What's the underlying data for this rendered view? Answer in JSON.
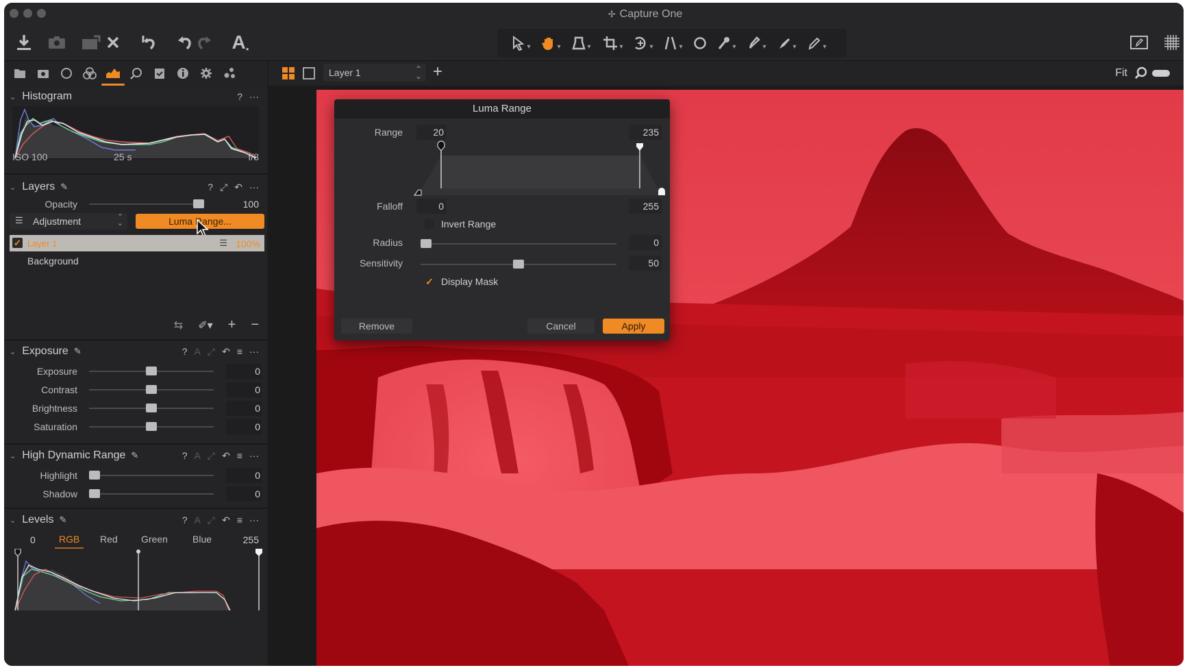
{
  "window": {
    "title": "Capture One",
    "title_icon": "capture-one-logo-icon"
  },
  "toolbar": {
    "left_icons": [
      "import-icon",
      "camera-capture-icon",
      "export-icon",
      "delete-icon",
      "reset-icon",
      "undo-icon",
      "redo-icon",
      "text-annotation-icon"
    ],
    "cursor_tools": [
      "select-cursor-icon",
      "pan-hand-icon",
      "loupe-icon",
      "crop-icon",
      "rotate-icon",
      "keystone-icon",
      "spot-removal-icon",
      "color-picker-icon",
      "brush-icon",
      "erase-brush-icon",
      "annotate-pencil-icon"
    ],
    "active_cursor_tool": "pan-hand-icon",
    "right_icons": [
      "proof-view-icon",
      "grid-overlay-icon"
    ]
  },
  "tool_tabs": {
    "items": [
      "library-tab",
      "capture-tab",
      "lens-tab",
      "color-tab",
      "exposure-tab",
      "details-tab",
      "adjustments-tab",
      "metadata-tab",
      "output-tab",
      "batch-tab"
    ],
    "active": "exposure-tab"
  },
  "viewer_bar": {
    "layer_select": "Layer 1",
    "zoom_label": "Fit"
  },
  "histogram": {
    "title": "Histogram",
    "iso": "ISO 100",
    "shutter": "25 s",
    "aperture": "f/8"
  },
  "layers": {
    "title": "Layers",
    "opacity_label": "Opacity",
    "opacity_value": "100",
    "opacity_fraction": 1.0,
    "mode_label": "Adjustment",
    "luma_button": "Luma Range...",
    "items": [
      {
        "name": "Layer 1",
        "opacity": "100%",
        "checked": true,
        "selected": true
      },
      {
        "name": "Background",
        "opacity": "",
        "checked": false,
        "selected": false
      }
    ]
  },
  "exposure": {
    "title": "Exposure",
    "sliders": [
      {
        "label": "Exposure",
        "value": "0",
        "fraction": 0.5
      },
      {
        "label": "Contrast",
        "value": "0",
        "fraction": 0.5
      },
      {
        "label": "Brightness",
        "value": "0",
        "fraction": 0.5
      },
      {
        "label": "Saturation",
        "value": "0",
        "fraction": 0.5
      }
    ]
  },
  "hdr": {
    "title": "High Dynamic Range",
    "sliders": [
      {
        "label": "Highlight",
        "value": "0",
        "fraction": 0.0
      },
      {
        "label": "Shadow",
        "value": "0",
        "fraction": 0.0
      }
    ]
  },
  "levels": {
    "title": "Levels",
    "low_value": "0",
    "high_value": "255",
    "channels": [
      "RGB",
      "Red",
      "Green",
      "Blue"
    ],
    "active_channel": "RGB"
  },
  "luma_dialog": {
    "title": "Luma Range",
    "range_label": "Range",
    "range_low": "20",
    "range_high": "235",
    "falloff_label": "Falloff",
    "falloff_low": "0",
    "falloff_high": "255",
    "invert_label": "Invert Range",
    "invert_checked": false,
    "radius_label": "Radius",
    "radius_value": "0",
    "radius_fraction": 0.0,
    "sensitivity_label": "Sensitivity",
    "sensitivity_value": "50",
    "sensitivity_fraction": 0.5,
    "display_mask_label": "Display Mask",
    "display_mask_checked": true,
    "remove_label": "Remove",
    "cancel_label": "Cancel",
    "apply_label": "Apply"
  },
  "colors": {
    "accent": "#f08a24",
    "mask_red": "#e0303f"
  }
}
